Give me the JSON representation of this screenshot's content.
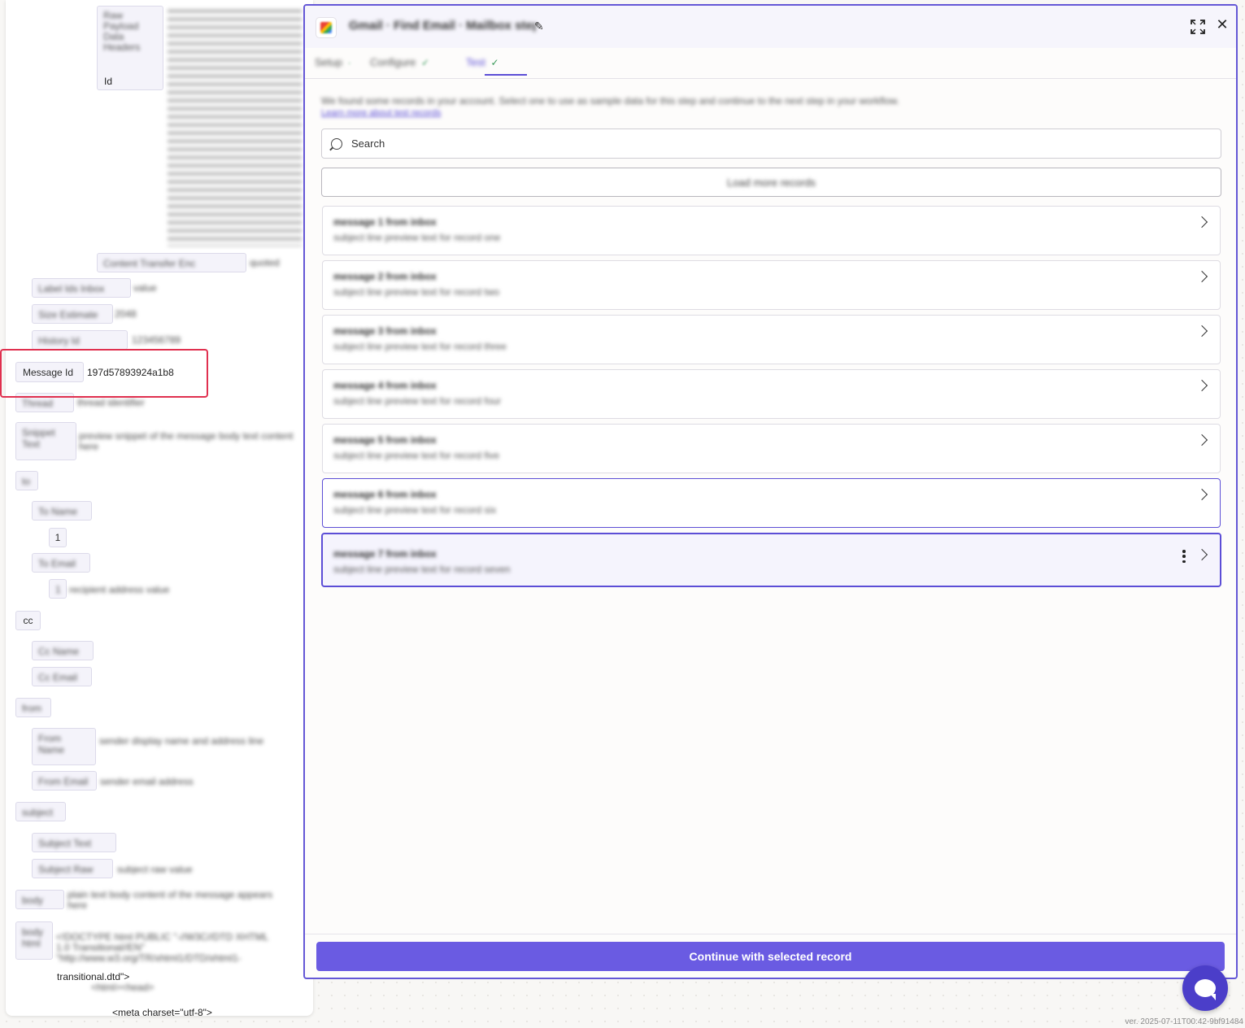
{
  "left_panel": {
    "top_tag_label": "Id",
    "message_id_label": "Message Id",
    "message_id_value": "197d57893924a1b8",
    "count_value": "1",
    "cc_label": "cc",
    "html_line_1": "transitional.dtd\">",
    "html_line_2": "<meta charset=\"utf-8\">"
  },
  "modal": {
    "title": "Gmail · Find Email · Mailbox step",
    "tabs": [
      {
        "label": "Setup",
        "state": "done"
      },
      {
        "label": "Configure",
        "state": "done"
      },
      {
        "label": "Test",
        "state": "active"
      }
    ],
    "description": "We found some records in your account. Select one to use as sample data for this step and continue to the next step in your workflow.",
    "learn_more": "Learn more about test records",
    "search_placeholder": "Search",
    "load_more_label": "Load more records",
    "records": [
      {
        "title": "message 1 from inbox",
        "subtitle": "subject line preview text for record one"
      },
      {
        "title": "message 2 from inbox",
        "subtitle": "subject line preview text for record two"
      },
      {
        "title": "message 3 from inbox",
        "subtitle": "subject line preview text for record three"
      },
      {
        "title": "message 4 from inbox",
        "subtitle": "subject line preview text for record four"
      },
      {
        "title": "message 5 from inbox",
        "subtitle": "subject line preview text for record five"
      },
      {
        "title": "message 6 from inbox",
        "subtitle": "subject line preview text for record six"
      },
      {
        "title": "message 7 from inbox",
        "subtitle": "subject line preview text for record seven"
      }
    ],
    "continue_label": "Continue with selected record"
  },
  "version": "ver. 2025-07-11T00:42-9bf91484",
  "colors": {
    "accent": "#6a5be2",
    "highlight": "#e0304f",
    "success": "#3a9a5a"
  }
}
